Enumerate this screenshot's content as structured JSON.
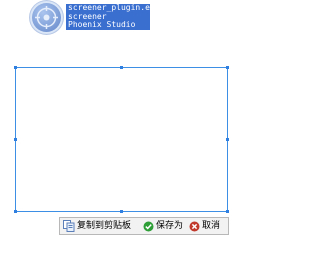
{
  "info": {
    "lines": [
      "screener_plugin.exe",
      "screener",
      "Phoenix Studio"
    ]
  },
  "toolbar": {
    "copy_label": "复制到剪贴板",
    "save_label": "保存为",
    "cancel_label": "取消",
    "icons": {
      "copy": "copy-icon",
      "save": "check-circle-icon",
      "cancel": "close-circle-icon"
    }
  },
  "colors": {
    "selection_border": "#3d8fe6",
    "info_bg": "#3a6fd0",
    "save_green": "#2e9e36",
    "cancel_red": "#c0392b"
  }
}
